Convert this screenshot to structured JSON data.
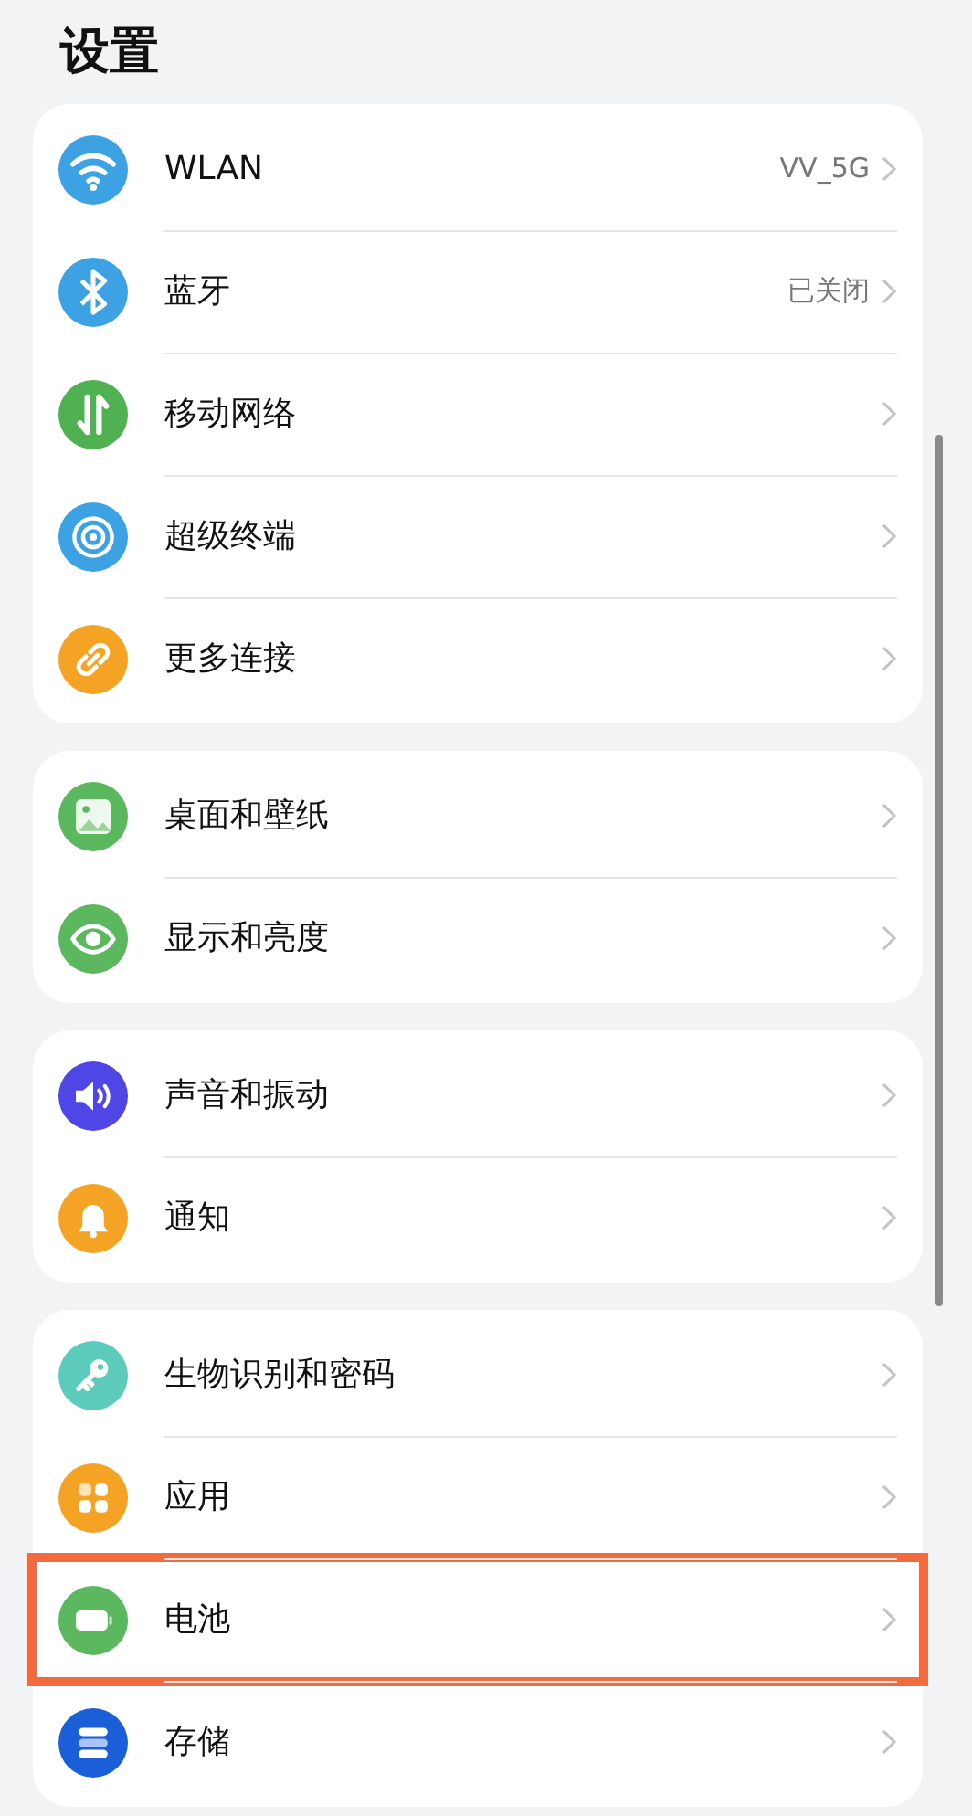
{
  "title": "设置",
  "groups": [
    {
      "items": [
        {
          "label": "WLAN",
          "value": "VV_5G",
          "highlighted": false
        },
        {
          "label": "蓝牙",
          "value": "已关闭",
          "highlighted": false
        },
        {
          "label": "移动网络",
          "highlighted": false
        },
        {
          "label": "超级终端",
          "highlighted": false
        },
        {
          "label": "更多连接",
          "highlighted": false
        }
      ]
    },
    {
      "items": [
        {
          "label": "桌面和壁纸",
          "highlighted": false
        },
        {
          "label": "显示和亮度",
          "highlighted": false
        }
      ]
    },
    {
      "items": [
        {
          "label": "声音和振动",
          "highlighted": false
        },
        {
          "label": "通知",
          "highlighted": false
        }
      ]
    },
    {
      "items": [
        {
          "label": "生物识别和密码",
          "highlighted": false
        },
        {
          "label": "应用",
          "highlighted": false
        },
        {
          "label": "电池",
          "highlighted": true
        },
        {
          "label": "存储",
          "highlighted": false
        }
      ]
    }
  ]
}
